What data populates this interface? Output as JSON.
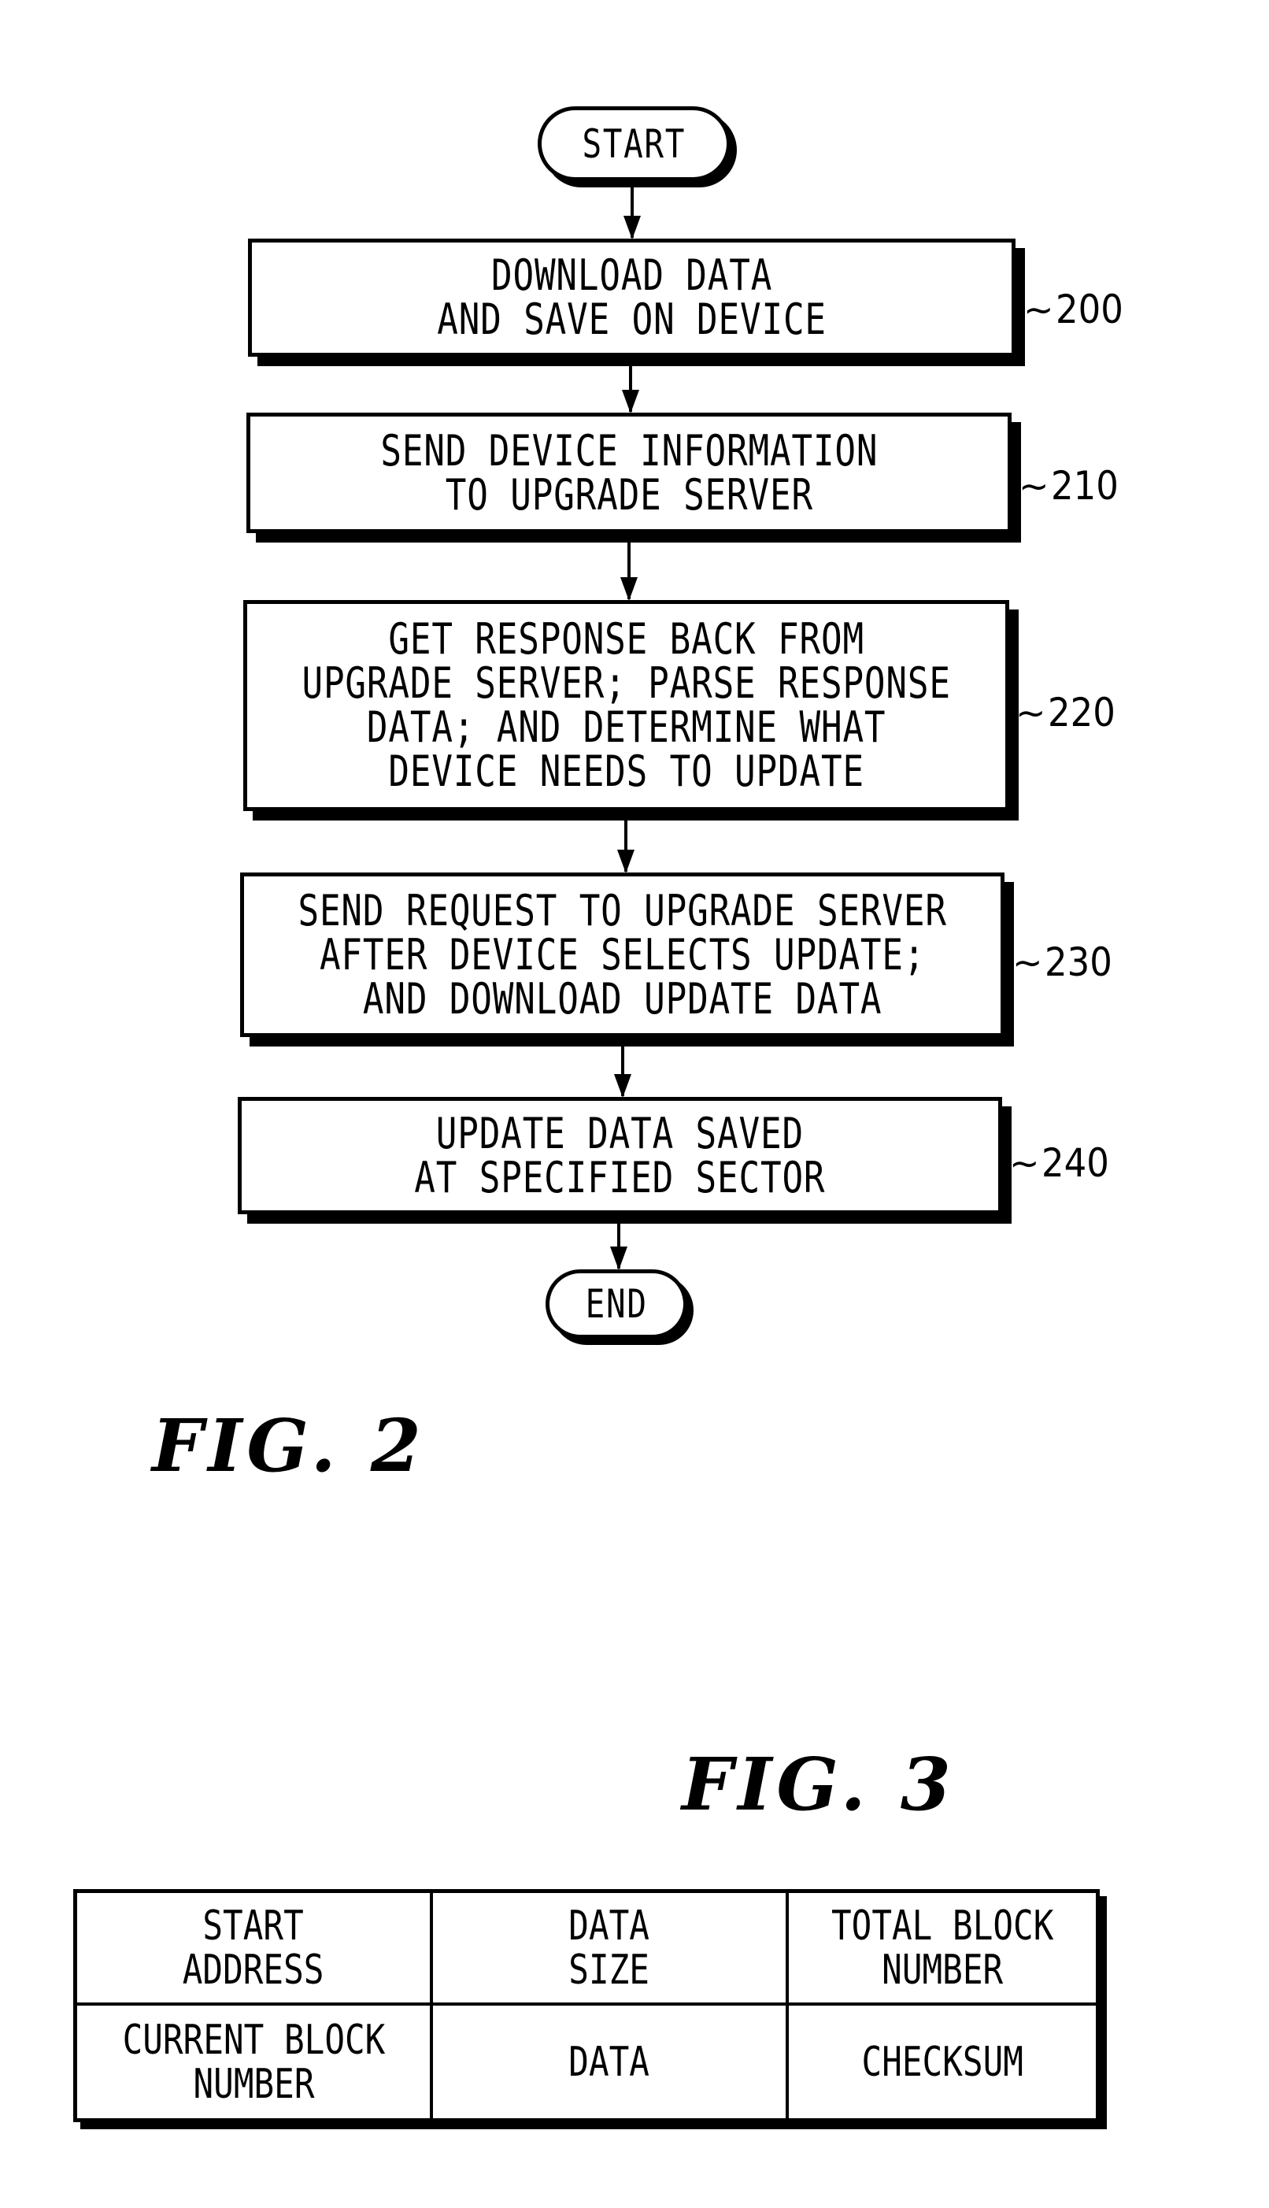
{
  "figure2": {
    "caption": "FIG. 2",
    "start_label": "START",
    "end_label": "END",
    "steps": [
      {
        "ref": "200",
        "lines": [
          "DOWNLOAD DATA",
          "AND SAVE ON DEVICE"
        ]
      },
      {
        "ref": "210",
        "lines": [
          "SEND DEVICE INFORMATION",
          "TO UPGRADE SERVER"
        ]
      },
      {
        "ref": "220",
        "lines": [
          "GET RESPONSE BACK FROM",
          "UPGRADE SERVER; PARSE RESPONSE",
          "DATA; AND DETERMINE WHAT",
          "DEVICE NEEDS TO UPDATE"
        ]
      },
      {
        "ref": "230",
        "lines": [
          "SEND REQUEST TO UPGRADE SERVER",
          "AFTER DEVICE SELECTS UPDATE;",
          "AND DOWNLOAD UPDATE DATA"
        ]
      },
      {
        "ref": "240",
        "lines": [
          "UPDATE DATA SAVED",
          "AT SPECIFIED SECTOR"
        ]
      }
    ],
    "ref_marker": "~"
  },
  "figure3": {
    "caption": "FIG. 3",
    "table": [
      [
        [
          "START",
          "ADDRESS"
        ],
        [
          "DATA",
          "SIZE"
        ],
        [
          "TOTAL BLOCK",
          "NUMBER"
        ]
      ],
      [
        [
          "CURRENT BLOCK",
          "NUMBER"
        ],
        [
          "DATA"
        ],
        [
          "CHECKSUM"
        ]
      ]
    ]
  }
}
